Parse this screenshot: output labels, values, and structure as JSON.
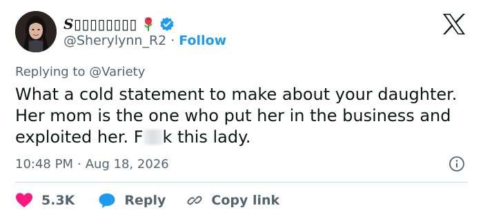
{
  "user": {
    "display_name": "S▯▯▯▯▯▯▯▯",
    "handle": "@Sherylynn_R2",
    "separator": "·",
    "follow_label": "Follow",
    "avatar_icon": "profile-photo",
    "emoji_icon": "rose-icon",
    "verified_icon": "verified-badge-icon"
  },
  "reply": {
    "prefix": "Replying to",
    "mention": "@Variety"
  },
  "tweet": {
    "text_before_blur": "What a cold statement to make about your daughter. Her mom is the one who put her in the business and exploited her. F",
    "text_after_blur": "k this lady.",
    "time": "10:48 PM",
    "dot": "·",
    "date": "Aug 18, 2026"
  },
  "actions": {
    "like_count": "5.3K",
    "reply_label": "Reply",
    "copy_label": "Copy link"
  },
  "colors": {
    "accent": "#1d9bf0",
    "like": "#f91880",
    "muted": "#536471",
    "text": "#0f1419"
  }
}
